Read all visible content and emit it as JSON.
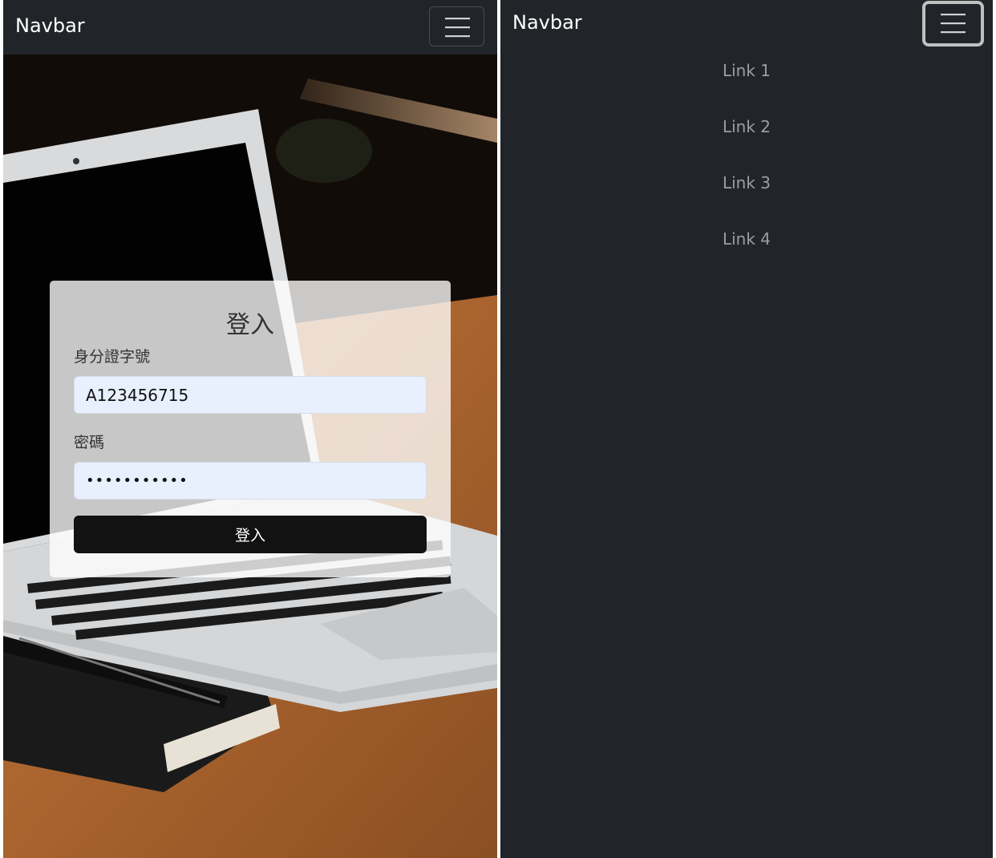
{
  "left_panel": {
    "navbar": {
      "brand": "Navbar",
      "toggler_icon": "hamburger-icon"
    },
    "login": {
      "title": "登入",
      "id_label": "身分證字號",
      "id_value": "A123456715",
      "password_label": "密碼",
      "password_value": "•••••••••••",
      "submit_label": "登入"
    }
  },
  "right_panel": {
    "navbar": {
      "brand": "Navbar",
      "toggler_icon": "hamburger-icon",
      "toggler_state": "focused"
    },
    "links": [
      {
        "label": "Link 1"
      },
      {
        "label": "Link 2"
      },
      {
        "label": "Link 3"
      },
      {
        "label": "Link 4"
      }
    ]
  },
  "colors": {
    "navbar_bg": "#212529",
    "link_color": "#8c8f92",
    "input_bg": "#e8f0fe",
    "button_bg": "#121212"
  }
}
